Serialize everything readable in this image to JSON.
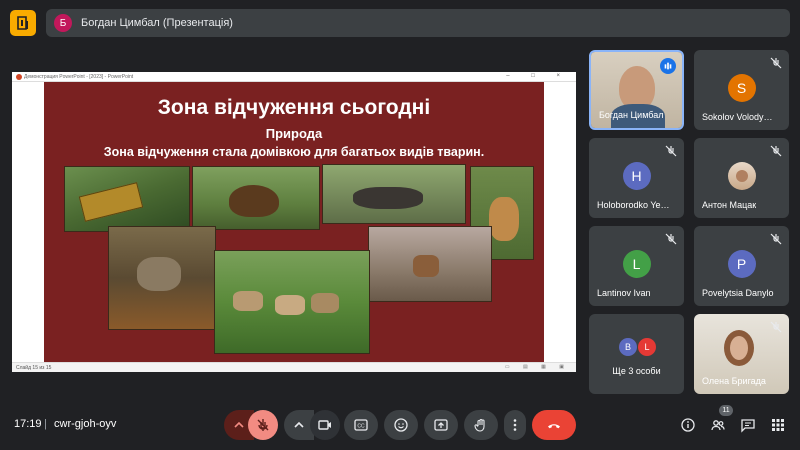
{
  "header": {
    "presenter_initial": "Б",
    "presenter_title": "Богдан Цимбал (Презентація)"
  },
  "ppt": {
    "window_title": "Демонстрация PowerPoint - [2023] - PowerPoint",
    "status_left": "Слайд 15 из 15",
    "slide_title": "Зона відчуження сьогодні",
    "slide_subtitle": "Природа",
    "slide_text": "Зона відчуження стала домівкою для багатьох видів тварин."
  },
  "participants": [
    {
      "name": "Богдан Цимбал",
      "initial": "",
      "color": "",
      "video": true,
      "speaking": true
    },
    {
      "name": "Sokolov Volody…",
      "initial": "S",
      "color": "#e37400",
      "muted": true
    },
    {
      "name": "Holoborodko Ye…",
      "initial": "H",
      "color": "#5c6bc0",
      "muted": true
    },
    {
      "name": "Антон Мацак",
      "initial": "",
      "color": "",
      "photo": true,
      "muted": true
    },
    {
      "name": "Lantinov Ivan",
      "initial": "L",
      "color": "#43a047",
      "muted": true
    },
    {
      "name": "Povelytsia Danylo",
      "initial": "P",
      "color": "#5c6bc0",
      "muted": true
    },
    {
      "name": "Олена Бригада",
      "initial": "",
      "color": "",
      "video": true,
      "muted": true
    }
  ],
  "more_tile": {
    "label": "Ще 3 особи",
    "initials": [
      "B",
      "L"
    ],
    "colors": [
      "#5c6bc0",
      "#e53935"
    ]
  },
  "bottom": {
    "time": "17:19",
    "separator": "|",
    "meeting_code": "cwr-gjoh-oyv",
    "participants_count": "11"
  },
  "colors": {
    "mic_off_bg": "#ea4335",
    "end_call": "#ea4335",
    "slide_bg": "#7a2121"
  }
}
